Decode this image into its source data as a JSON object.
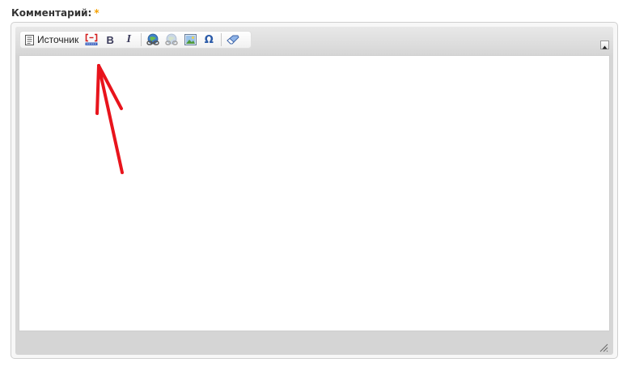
{
  "field": {
    "label": "Комментарий:",
    "required_mark": "*"
  },
  "toolbar": {
    "source_label": "Источник",
    "buttons": [
      {
        "name": "source-icon"
      },
      {
        "name": "code-icon"
      },
      {
        "name": "bold-icon",
        "glyph": "B"
      },
      {
        "name": "italic-icon",
        "glyph": "I"
      },
      {
        "name": "link-icon"
      },
      {
        "name": "unlink-icon"
      },
      {
        "name": "image-icon"
      },
      {
        "name": "special-char-icon",
        "glyph": "Ω"
      },
      {
        "name": "eraser-icon"
      }
    ]
  },
  "editor": {
    "content": ""
  },
  "annotation": {
    "arrow_color": "#e8141c"
  },
  "colors": {
    "required_mark": "#f5a100",
    "label": "#333333"
  }
}
